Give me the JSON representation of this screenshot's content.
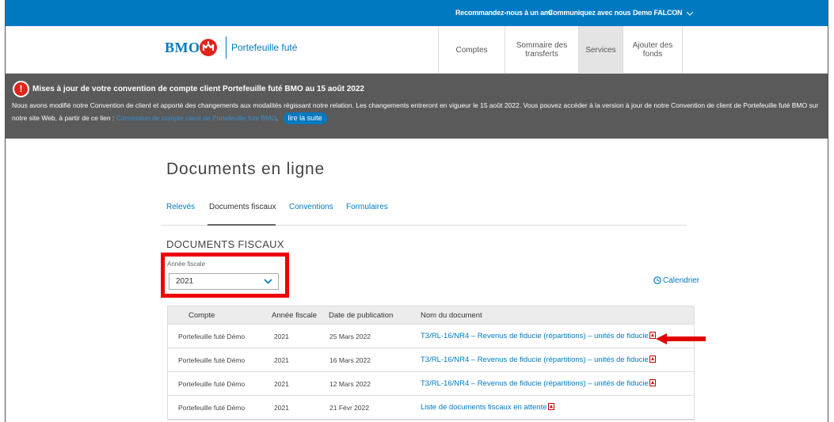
{
  "topbar": {
    "refer_link": "Recommandez-nous à un ami",
    "contact_link": "Communiquez avec nous",
    "user_menu": "Demo FALCON"
  },
  "header": {
    "brand": "BMO",
    "product": "Portefeuille futé",
    "nav": [
      "Comptes",
      "Sommaire des transferts",
      "Services",
      "Ajouter des fonds"
    ]
  },
  "alert": {
    "title": "Mises à jour de votre convention de compte client Portefeuille futé BMO au 15 août 2022",
    "body": "Nous avons modifié notre Convention de client et apporté des changements aux modalités régissant notre relation. Les changements entreront en vigueur le 15 août 2022. Vous pouvez accéder à la version à jour de notre Convention de client de Portefeuille futé BMO sur notre site Web, à partir de ce lien :",
    "link_text": "Convention de compte client de Portefeuille futé BMO",
    "button": "lire la suite"
  },
  "main": {
    "page_title": "Documents en ligne",
    "tabs": [
      "Relevés",
      "Documents fiscaux",
      "Conventions",
      "Formulaires"
    ],
    "section_title": "DOCUMENTS FISCAUX",
    "year_label": "Année fiscale",
    "year_value": "2021",
    "calendar_link": "Calendrier"
  },
  "table": {
    "headers": [
      "Compte",
      "Année fiscale",
      "Date de publication",
      "Nom du document"
    ],
    "rows": [
      [
        "Portefeuille futé Démo",
        "2021",
        "25 Mars 2022",
        "T3/RL-16/NR4 – Revenus de fiducie (répartitions) – unités de fiducie"
      ],
      [
        "Portefeuille futé Démo",
        "2021",
        "16 Mars 2022",
        "T3/RL-16/NR4 – Revenus de fiducie (répartitions) – unités de fiducie"
      ],
      [
        "Portefeuille futé Démo",
        "2021",
        "12 Mars 2022",
        "T3/RL-16/NR4 – Revenus de fiducie (répartitions) – unités de fiducie"
      ],
      [
        "Portefeuille futé Démo",
        "2021",
        "21 Févr 2022",
        "Liste de documents fiscaux en attente"
      ]
    ]
  },
  "colors": {
    "brand_blue": "#0079c1",
    "brand_red": "#e2231a",
    "alert_bg": "#5a5a5a",
    "highlight_red": "#e00000"
  },
  "icons": [
    "chevron-down-icon",
    "bmo-logo-icon",
    "alert-icon",
    "clock-icon",
    "pdf-icon",
    "red-arrow-icon"
  ]
}
